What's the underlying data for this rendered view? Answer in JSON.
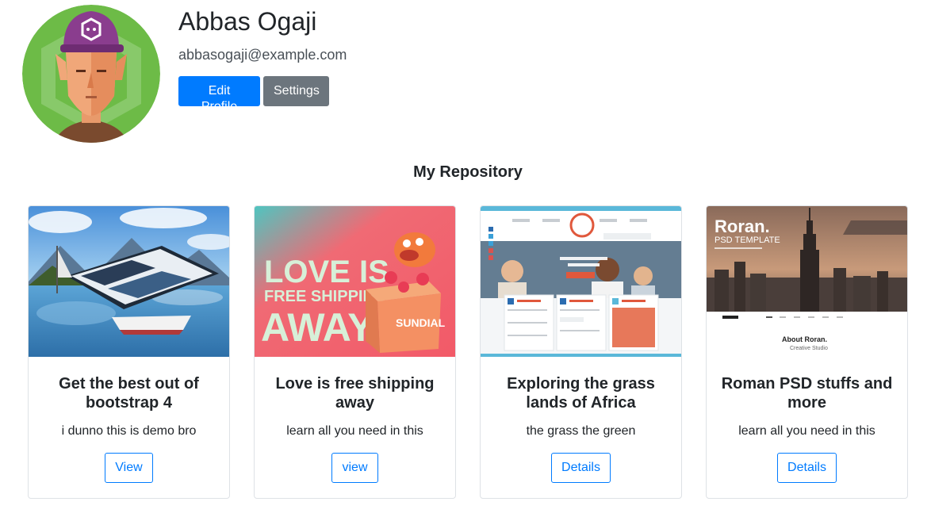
{
  "profile": {
    "name": "Abbas Ogaji",
    "email": "abbasogaji@example.com",
    "edit_label": "Edit Profile",
    "settings_label": "Settings",
    "primary_color": "#007bff",
    "secondary_color": "#6c757d"
  },
  "repository": {
    "title": "My Repository"
  },
  "cards": [
    {
      "title": "Get the best out of bootstrap 4",
      "text": "i dunno this is demo bro",
      "button": "View"
    },
    {
      "title": "Love is free shipping away",
      "text": "learn all you need in this",
      "button": "view",
      "image_text": {
        "line1": "LOVE IS",
        "line2": "FREE SHIPPING",
        "line3": "AWAY",
        "brand": "SUNDIAL"
      }
    },
    {
      "title": "Exploring the grass lands of Africa",
      "text": "the grass the green",
      "button": "Details"
    },
    {
      "title": "Roman PSD stuffs and more",
      "text": "learn all you need in this",
      "button": "Details",
      "image_text": {
        "brand": "Roran.",
        "subtitle": "PSD TEMPLATE",
        "about": "About Roran.",
        "studio": "Creative Studio"
      }
    }
  ]
}
